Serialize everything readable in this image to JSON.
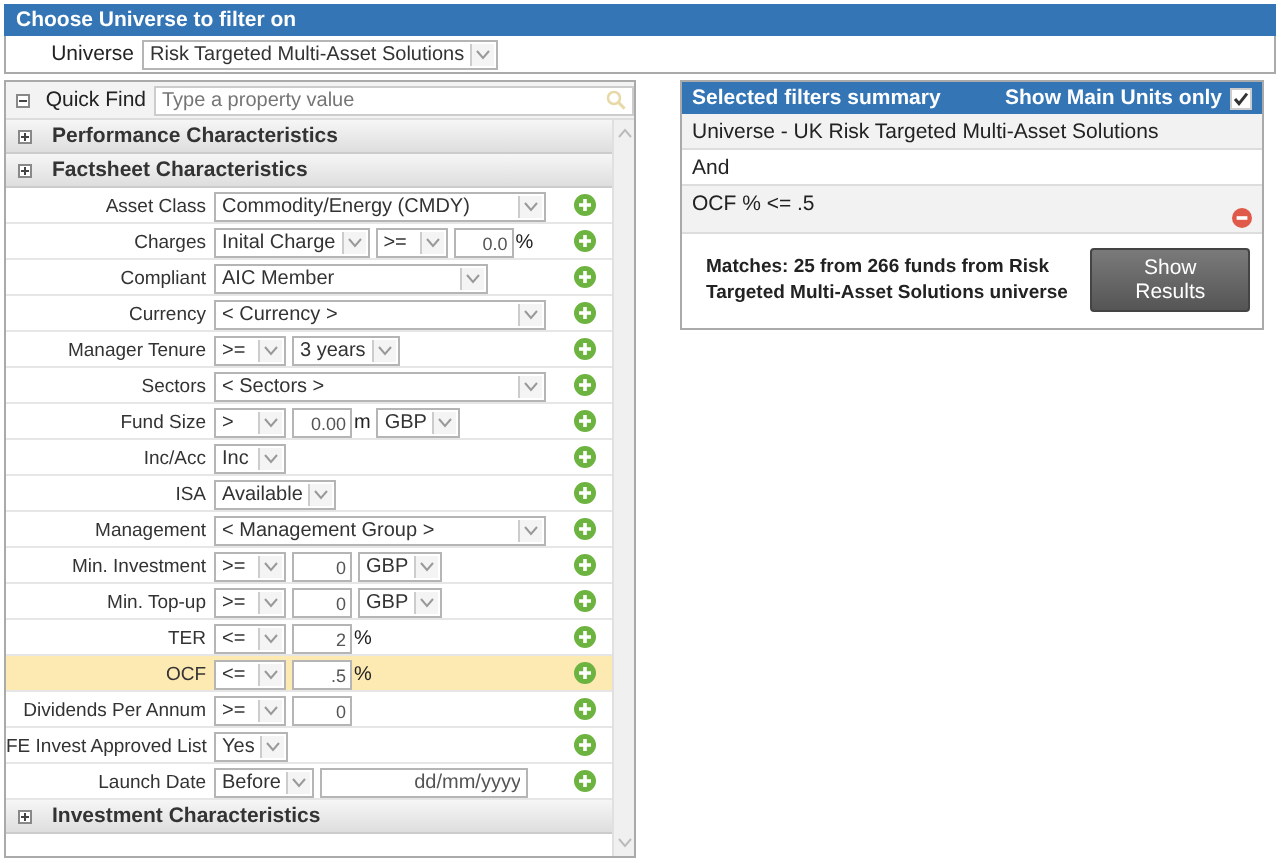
{
  "universe_panel": {
    "title": "Choose Universe to filter on",
    "label": "Universe",
    "value": "Risk Targeted Multi-Asset Solutions"
  },
  "filter_panel": {
    "quick_find": {
      "label": "Quick Find",
      "placeholder": "Type a property value"
    },
    "sections_before": [
      {
        "title": "Performance Characteristics"
      },
      {
        "title": "Factsheet Characteristics"
      }
    ],
    "rows": [
      {
        "label": "Asset Class",
        "highlighted": false,
        "controls": [
          {
            "kind": "dropdown-wide",
            "value": "Commodity/Energy (CMDY)"
          }
        ]
      },
      {
        "label": "Charges",
        "highlighted": false,
        "controls": [
          {
            "kind": "dropdown",
            "value": "Inital Charge"
          },
          {
            "kind": "dropdown",
            "value": ">="
          },
          {
            "kind": "number",
            "value": "0.0"
          },
          {
            "kind": "unit",
            "value": "%"
          }
        ]
      },
      {
        "label": "Compliant",
        "highlighted": false,
        "controls": [
          {
            "kind": "dropdown-medium",
            "value": "AIC Member"
          }
        ]
      },
      {
        "label": "Currency",
        "highlighted": false,
        "controls": [
          {
            "kind": "dropdown-wide",
            "value": "< Currency >"
          }
        ]
      },
      {
        "label": "Manager Tenure",
        "highlighted": false,
        "controls": [
          {
            "kind": "dropdown",
            "value": ">="
          },
          {
            "kind": "dropdown",
            "value": "3 years"
          }
        ]
      },
      {
        "label": "Sectors",
        "highlighted": false,
        "controls": [
          {
            "kind": "dropdown-wide",
            "value": "< Sectors >"
          }
        ]
      },
      {
        "label": "Fund Size",
        "highlighted": false,
        "controls": [
          {
            "kind": "dropdown",
            "value": ">"
          },
          {
            "kind": "number",
            "value": "0.00"
          },
          {
            "kind": "unit",
            "value": "m"
          },
          {
            "kind": "dropdown",
            "value": "GBP"
          }
        ]
      },
      {
        "label": "Inc/Acc",
        "highlighted": false,
        "controls": [
          {
            "kind": "dropdown",
            "value": "Inc"
          }
        ]
      },
      {
        "label": "ISA",
        "highlighted": false,
        "controls": [
          {
            "kind": "dropdown",
            "value": "Available"
          }
        ]
      },
      {
        "label": "Management",
        "highlighted": false,
        "controls": [
          {
            "kind": "dropdown-wide",
            "value": "< Management Group >"
          }
        ]
      },
      {
        "label": "Min. Investment",
        "highlighted": false,
        "controls": [
          {
            "kind": "dropdown",
            "value": ">="
          },
          {
            "kind": "number",
            "value": "0"
          },
          {
            "kind": "dropdown",
            "value": "GBP"
          }
        ]
      },
      {
        "label": "Min. Top-up",
        "highlighted": false,
        "controls": [
          {
            "kind": "dropdown",
            "value": ">="
          },
          {
            "kind": "number",
            "value": "0"
          },
          {
            "kind": "dropdown",
            "value": "GBP"
          }
        ]
      },
      {
        "label": "TER",
        "highlighted": false,
        "controls": [
          {
            "kind": "dropdown",
            "value": "<="
          },
          {
            "kind": "number",
            "value": "2"
          },
          {
            "kind": "unit",
            "value": "%"
          }
        ]
      },
      {
        "label": "OCF",
        "highlighted": true,
        "controls": [
          {
            "kind": "dropdown",
            "value": "<="
          },
          {
            "kind": "number",
            "value": ".5"
          },
          {
            "kind": "unit",
            "value": "%"
          }
        ]
      },
      {
        "label": "Dividends Per Annum",
        "highlighted": false,
        "controls": [
          {
            "kind": "dropdown",
            "value": ">="
          },
          {
            "kind": "number",
            "value": "0"
          }
        ]
      },
      {
        "label": "FE Invest Approved List",
        "highlighted": false,
        "controls": [
          {
            "kind": "dropdown",
            "value": "Yes"
          }
        ]
      },
      {
        "label": "Launch Date",
        "highlighted": false,
        "controls": [
          {
            "kind": "dropdown",
            "value": "Before"
          },
          {
            "kind": "date",
            "value": "dd/mm/yyyy"
          }
        ]
      }
    ],
    "sections_after": [
      {
        "title": "Investment Characteristics"
      }
    ]
  },
  "summary_panel": {
    "title": "Selected filters summary",
    "main_units_label": "Show Main Units only",
    "main_units_checked": true,
    "items": [
      {
        "kind": "universe",
        "text": "Universe - UK Risk Targeted Multi-Asset Solutions"
      },
      {
        "kind": "operator",
        "text": "And"
      },
      {
        "kind": "filter",
        "text": "OCF % <= .5"
      }
    ],
    "matches": "Matches: 25 from 266 funds from Risk Targeted Multi-Asset Solutions universe",
    "button": "Show Results"
  }
}
